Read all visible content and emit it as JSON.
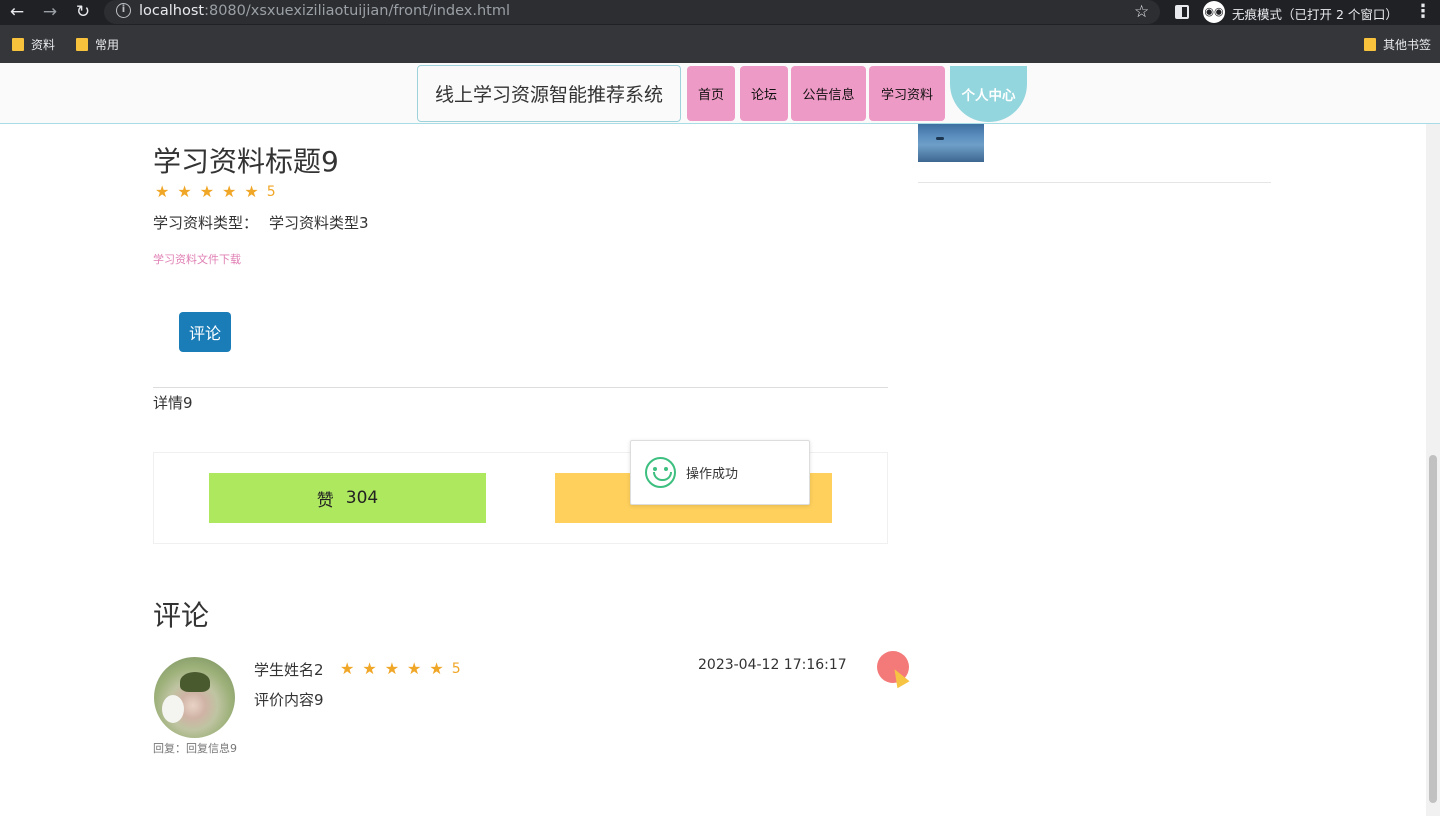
{
  "browser": {
    "back_icon": "arrow-left-icon",
    "forward_icon": "arrow-right-icon",
    "reload_icon": "reload-icon",
    "info_icon": "info-icon",
    "url_host": "localhost",
    "url_path": ":8080/xsxuexiziliaotuijian/front/index.html",
    "incognito_label": "无痕模式（已打开 2 个窗口）",
    "bookmarks": [
      "资料",
      "常用"
    ],
    "other_bookmarks": "其他书签"
  },
  "nav": {
    "site_title": "线上学习资源智能推荐系统",
    "items": [
      "首页",
      "论坛",
      "公告信息",
      "学习资料"
    ],
    "profile": "个人中心"
  },
  "resource": {
    "title": "学习资料标题9",
    "rating": "5",
    "stars": 5,
    "type_label": "学习资料类型：",
    "type_value": "学习资料类型3",
    "download_link": "学习资料文件下载",
    "comment_button": "评论",
    "detail": "详情9"
  },
  "vote": {
    "like_label": "赞",
    "like_count": "304"
  },
  "toast": {
    "message": "操作成功",
    "icon": "smile-icon"
  },
  "comments": {
    "heading": "评论",
    "items": [
      {
        "user": "学生姓名2",
        "rating": "5",
        "stars": 5,
        "content": "评价内容9",
        "time": "2023-04-12 17:16:17",
        "reply": "回复：回复信息9"
      }
    ]
  },
  "colors": {
    "nav_item": "#ee9ac6",
    "nav_profile": "#93d6de",
    "comment_button": "#1a7db8",
    "like": "#aee85f",
    "dislike": "#ffd05c",
    "star": "#f0a626",
    "delete": "#f47a7a"
  }
}
